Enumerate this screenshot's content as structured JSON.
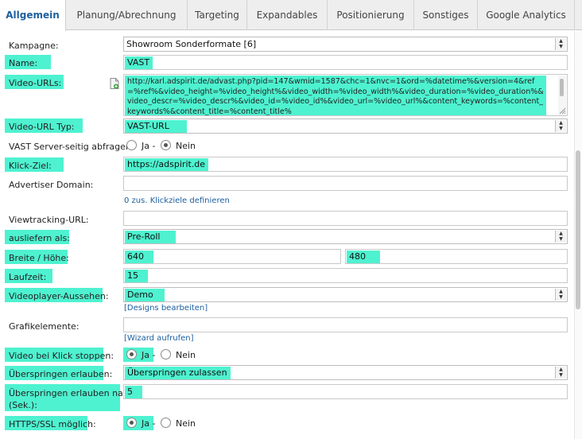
{
  "tabs": [
    {
      "label": "Allgemein",
      "active": true
    },
    {
      "label": "Planung/Abrechnung"
    },
    {
      "label": "Targeting"
    },
    {
      "label": "Expandables"
    },
    {
      "label": "Positionierung"
    },
    {
      "label": "Sonstiges"
    },
    {
      "label": "Google Analytics"
    }
  ],
  "fields": {
    "kampagne": {
      "label": "Kampagne:",
      "value": "Showroom Sonderformate [6]"
    },
    "name": {
      "label": "Name:",
      "value": "VAST"
    },
    "video_urls": {
      "label": "Video-URLs:",
      "value": "http://karl.adspirit.de/advast.php?pid=147&wmid=1587&chc=1&nvc=1&ord=%datetime%&version=4&ref=%ref%&video_height=%video_height%&video_width=%video_width%&video_duration=%video_duration%&video_descr=%video_descr%&video_id=%video_id%&video_url=%video_url%&content_keywords=%content_keywords%&content_title=%content_title%"
    },
    "video_url_typ": {
      "label": "Video-URL Typ:",
      "value": "VAST-URL"
    },
    "vast_server": {
      "label": "VAST Server-seitig abfragen:",
      "option_yes": "Ja -",
      "option_no": "Nein"
    },
    "klick_ziel": {
      "label": "Klick-Ziel:",
      "value": "https://adspirit.de"
    },
    "advertiser_domain": {
      "label": "Advertiser Domain:",
      "value": ""
    },
    "klickziele_link": "0 zus. Klickziele definieren",
    "viewtracking": {
      "label": "Viewtracking-URL:",
      "value": ""
    },
    "ausliefern": {
      "label": "ausliefern als:",
      "value": "Pre-Roll"
    },
    "breite_hoehe": {
      "label": "Breite / Höhe:",
      "width": "640",
      "height": "480"
    },
    "laufzeit": {
      "label": "Laufzeit:",
      "value": "15"
    },
    "videoplayer": {
      "label": "Videoplayer-Aussehen:",
      "value": "Demo"
    },
    "designs_link": "[Designs bearbeiten]",
    "grafikelemente": {
      "label": "Grafikelemente:",
      "value": ""
    },
    "wizard_link": "[Wizard aufrufen]",
    "video_stoppen": {
      "label": "Video bei Klick stoppen:",
      "option_yes": "Ja -",
      "option_no": "Nein"
    },
    "ueberspringen": {
      "label": "Überspringen erlauben:",
      "value": "Überspringen zulassen"
    },
    "ueberspringen_nach": {
      "label_line1": "Überspringen erlauben nach",
      "label_line2": "(Sek.):",
      "value": "5"
    },
    "https": {
      "label": "HTTPS/SSL möglich:",
      "option_yes": "Ja -",
      "option_no": "Nein"
    }
  },
  "colors": {
    "highlight": "#4ef2d0",
    "link": "#1d5fa0",
    "active_tab": "#1d5fa0"
  },
  "icons": {
    "select_arrow": "arrow-updown-icon",
    "url_attach": "document-add-icon"
  }
}
